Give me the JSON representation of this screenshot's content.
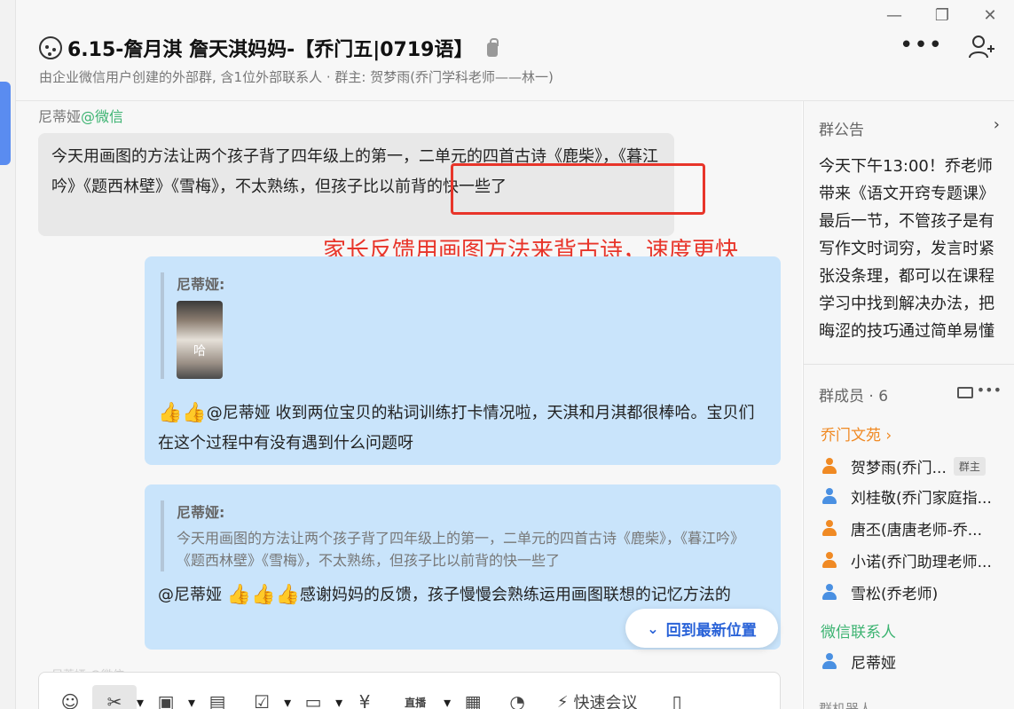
{
  "window": {
    "minimize": "—",
    "restore": "❐",
    "close": "✕"
  },
  "header": {
    "title": "6.15-詹月淇 詹天淇妈妈-【乔门五|0719语】",
    "subtitle": "由企业微信用户创建的外部群, 含1位外部联系人 · 群主: 贺梦雨(乔门学科老师——林一)",
    "more": "•••"
  },
  "chat": {
    "sender_name": "尼蒂娅",
    "sender_source": "@微信",
    "parent_message": "今天用画图的方法让两个孩子背了四年级上的第一，二单元的四首古诗《鹿柴》，《暮江吟》《题西林壁》《雪梅》，不太熟练，但孩子比以前背的快一些了",
    "annotation": "家长反馈用画图方法来背古诗，速度更快",
    "reply1": {
      "quote_name": "尼蒂娅:",
      "image_caption": "哈",
      "thumbs": "👍👍",
      "text": "@尼蒂娅 收到两位宝贝的粘词训练打卡情况啦，天淇和月淇都很棒哈。宝贝们在这个过程中有没有遇到什么问题呀"
    },
    "reply2": {
      "quote_name": "尼蒂娅:",
      "quote_text": "今天用画图的方法让两个孩子背了四年级上的第一，二单元的四首古诗《鹿柴》，《暮江吟》《题西林壁》《雪梅》，不太熟练，但孩子比以前背的快一些了",
      "prefix": "@尼蒂娅",
      "thumbs": "👍👍👍",
      "text": "感谢妈妈的反馈，孩子慢慢会熟练运用画图联想的记忆方法的"
    },
    "back_to_latest": "回到最新位置",
    "faded_sender": "尼蒂娅 @微信"
  },
  "toolbar": {
    "items": [
      {
        "name": "emoji-icon",
        "glyph": "☺"
      },
      {
        "name": "screenshot-icon",
        "glyph": "✂"
      },
      {
        "name": "image-icon",
        "glyph": "▣"
      },
      {
        "name": "document-icon",
        "glyph": "▤"
      },
      {
        "name": "task-icon",
        "glyph": "☑"
      },
      {
        "name": "folder-icon",
        "glyph": "▭"
      },
      {
        "name": "payment-icon",
        "glyph": "¥"
      },
      {
        "name": "live-icon",
        "glyph": "直播"
      },
      {
        "name": "apps-icon",
        "glyph": "▦"
      },
      {
        "name": "chat-bubble-icon",
        "glyph": "◔"
      }
    ],
    "quick_meeting": "快速会议"
  },
  "side": {
    "notice_title": "群公告",
    "notice_body": "今天下午13:00！乔老师带来《语文开窍专题课》最后一节，不管孩子是有写作文时词穷，发言时紧张没条理，都可以在课程学习中找到解决办法，把晦涩的技巧通过简单易懂的形式",
    "members_title": "群成员 · 6",
    "group_label_1": "乔门文苑 ›",
    "group_label_2": "微信联系人",
    "members": [
      {
        "name": "贺梦雨(乔门...",
        "badge": "群主",
        "color": "#f08a24"
      },
      {
        "name": "刘桂敬(乔门家庭指...",
        "badge": "",
        "color": "#4a90e2"
      },
      {
        "name": "唐丕(唐唐老师-乔...",
        "badge": "",
        "color": "#f08a24"
      },
      {
        "name": "小诺(乔门助理老师...",
        "badge": "",
        "color": "#f08a24"
      },
      {
        "name": "雪松(乔老师)",
        "badge": "",
        "color": "#4a90e2"
      }
    ],
    "wechat_member": {
      "name": "尼蒂娅",
      "color": "#4a90e2"
    },
    "faded_footer": "群机器人"
  }
}
